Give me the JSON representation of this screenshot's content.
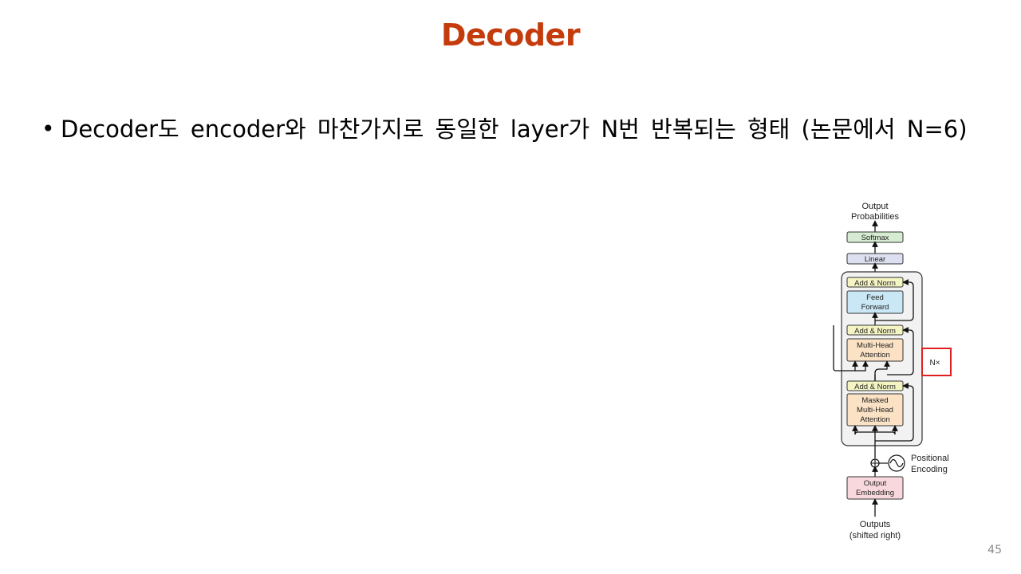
{
  "slide": {
    "title": "Decoder",
    "bullet": "Decoder도 encoder와 마찬가지로 동일한 layer가 N번 반복되는 형태 (논문에서 N=6)",
    "page_number": "45"
  },
  "diagram": {
    "output_line1": "Output",
    "output_line2": "Probabilities",
    "softmax": "Softmax",
    "linear": "Linear",
    "add_norm": "Add & Norm",
    "feed_forward_line1": "Feed",
    "feed_forward_line2": "Forward",
    "mha_line1": "Multi-Head",
    "mha_line2": "Attention",
    "masked_line1": "Masked",
    "masked_line2": "Multi-Head",
    "masked_line3": "Attention",
    "nx": "N×",
    "positional_line1": "Positional",
    "positional_line2": "Encoding",
    "embedding_line1": "Output",
    "embedding_line2": "Embedding",
    "outputs_line1": "Outputs",
    "outputs_line2": "(shifted right)",
    "colors": {
      "softmax": "#d6ecd2",
      "linear": "#dde0f0",
      "add_norm": "#f5f5c4",
      "feed_forward": "#c9e7f5",
      "attention": "#fbe2c4",
      "embedding": "#f8d8dc",
      "nx_box": "#e02020",
      "title": "#c43b0c"
    }
  }
}
